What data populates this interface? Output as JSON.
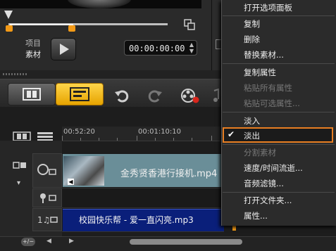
{
  "player": {
    "mode_project": "项目",
    "mode_clip": "素材",
    "timecode": "00:00:00:00"
  },
  "timeline": {
    "ruler_marks": [
      "00:52:20",
      "00:01:10:10"
    ],
    "video_clip_title": "金秀贤香港行接机.mp4",
    "audio_clip_title": "校园快乐帮 - 爱一直闪亮.mp3"
  },
  "context_menu": {
    "items": [
      {
        "label": "打开选项面板",
        "enabled": true
      },
      {
        "label": "复制",
        "enabled": true
      },
      {
        "label": "删除",
        "enabled": true
      },
      {
        "label": "替换素材...",
        "enabled": true
      },
      {
        "label": "复制属性",
        "enabled": true
      },
      {
        "label": "粘贴所有属性",
        "enabled": false
      },
      {
        "label": "粘贴可选属性...",
        "enabled": false
      },
      {
        "label": "淡入",
        "enabled": true
      },
      {
        "label": "淡出",
        "enabled": true,
        "checked": true,
        "highlighted": true
      },
      {
        "label": "分割素材",
        "enabled": false
      },
      {
        "label": "速度/时间流逝...",
        "enabled": true
      },
      {
        "label": "音频滤镜...",
        "enabled": true
      },
      {
        "label": "打开文件夹...",
        "enabled": true
      },
      {
        "label": "属性...",
        "enabled": true
      }
    ],
    "highlight_color": "#e87e22"
  },
  "colors": {
    "accent": "#f39a17",
    "timeline_button": "#f5bd1e",
    "video_clip": "#6a8e98",
    "audio_clip": "#0a1f7a"
  }
}
